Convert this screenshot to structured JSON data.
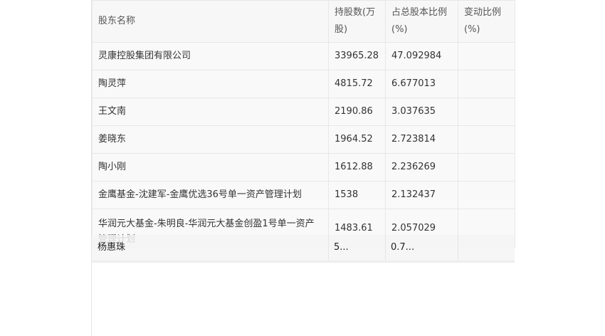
{
  "table": {
    "headers": [
      "股东名称",
      "持股数(万股)",
      "占总股本比例(%)",
      "变动比例(%)"
    ],
    "rows": [
      [
        "灵康控股集团有限公司",
        "33965.28",
        "47.092984",
        ""
      ],
      [
        "陶灵萍",
        "4815.72",
        "6.677013",
        ""
      ],
      [
        "王文南",
        "2190.86",
        "3.037635",
        ""
      ],
      [
        "姜晓东",
        "1964.52",
        "2.723814",
        ""
      ],
      [
        "陶小刚",
        "1612.88",
        "2.236269",
        ""
      ],
      [
        "金鹰基金-沈建军-金鹰优选36号单一资产管理计划",
        "1538",
        "2.132437",
        ""
      ],
      [
        "华润元大基金-朱明良-华润元大基金创盈1号单一资产管理计划",
        "1483.61",
        "2.057029",
        ""
      ]
    ],
    "overlay_row": [
      "杨惠珠",
      "5... ",
      "0.7..."
    ]
  }
}
